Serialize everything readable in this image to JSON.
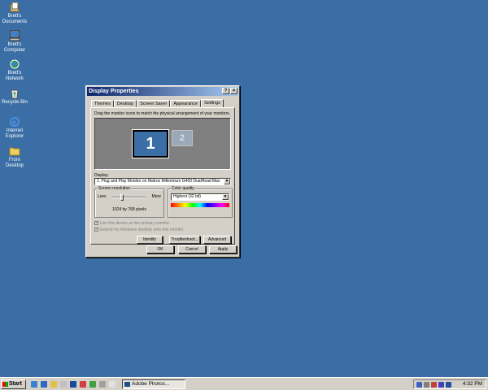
{
  "desktop": {
    "icons": [
      {
        "label": "Brett's Documents",
        "icon": "my-documents-icon"
      },
      {
        "label": "Brett's Computer",
        "icon": "my-computer-icon"
      },
      {
        "label": "Brett's Network",
        "icon": "network-icon"
      },
      {
        "label": "Recycle Bin",
        "icon": "recycle-bin-icon"
      },
      {
        "label": "Internet Explorer",
        "icon": "internet-explorer-icon"
      },
      {
        "label": "From Desktop",
        "icon": "folder-icon"
      }
    ],
    "background_color": "#3a6ea5"
  },
  "dialog": {
    "title": "Display Properties",
    "help_label": "?",
    "close_label": "×",
    "tabs": [
      {
        "label": "Themes",
        "active": false
      },
      {
        "label": "Desktop",
        "active": false
      },
      {
        "label": "Screen Saver",
        "active": false
      },
      {
        "label": "Appearance",
        "active": false
      },
      {
        "label": "Settings",
        "active": true
      }
    ],
    "instruction": "Drag the monitor icons to match the physical arrangement of your monitors.",
    "monitors": [
      {
        "number": "1",
        "selected": true
      },
      {
        "number": "2",
        "selected": false
      }
    ],
    "display_label": "Display:",
    "display_value": "1. Plug and Play Monitor on Matrox Millennium G400 DualHead Max",
    "resolution": {
      "group_title": "Screen resolution",
      "less": "Less",
      "more": "More",
      "value": "1024 by 768 pixels"
    },
    "color_quality": {
      "group_title": "Color quality",
      "value": "Highest (32 bit)"
    },
    "checkboxes": [
      {
        "label": "Use this device as the primary monitor",
        "checked": true,
        "enabled": false
      },
      {
        "label": "Extend my Windows desktop onto this monitor",
        "checked": true,
        "enabled": false
      }
    ],
    "buttons": {
      "identify": "Identify",
      "troubleshoot": "Troubleshoot...",
      "advanced": "Advanced",
      "ok": "OK",
      "cancel": "Cancel",
      "apply": "Apply"
    }
  },
  "taskbar": {
    "start_label": "Start",
    "active_task": "Adobe Photos...",
    "clock": "4:32 PM"
  }
}
